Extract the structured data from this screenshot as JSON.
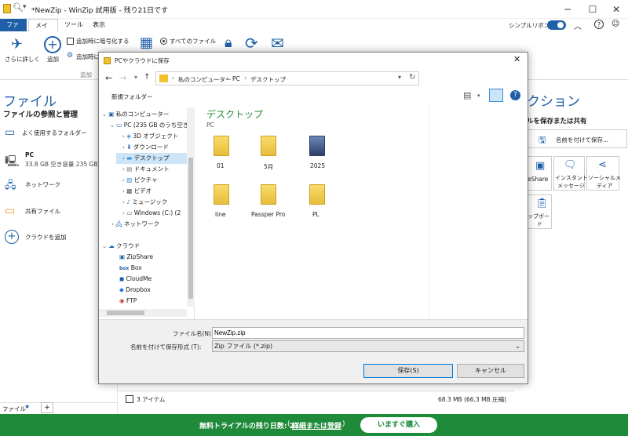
{
  "titlebar": {
    "title": "*NewZip - WinZip 試用版 - 残り21日です"
  },
  "tabs": [
    "ファイル",
    "メイン",
    "ツール",
    "表示"
  ],
  "ribbon": {
    "more_label": "さらに詳しく",
    "add_label": "追加",
    "encrypt_label": "追加時に暗号化する",
    "add_when_label": "追加時に",
    "group_add_label": "追加",
    "all_files_label": "すべてのファイル",
    "simple_ribbon_label": "シンプルリボン"
  },
  "leftpane": {
    "title": "ファイル",
    "subtitle": "ファイルの参照と管理",
    "frequent": "よく使用するフォルダー",
    "pc_label": "PC",
    "pc_detail": "33.8 GB 空き容量 235 GB",
    "network": "ネットワーク",
    "shared": "共有ファイル",
    "add_cloud": "クラウドを追加",
    "bottom_tab": "ファイル"
  },
  "rightpane": {
    "title": "クション",
    "subtitle": "ルを保存または共有",
    "save_as": "名前を付けて保存...",
    "meshare": "eShare",
    "instant1": "インスタント",
    "instant2": "メッセージ",
    "social1": "ソーシャルメ",
    "social2": "ディア",
    "clipboard1": "ップボー",
    "clipboard2": "ド"
  },
  "status": {
    "items": "3 アイテム",
    "size": "68.3 MB (66.3 MB 圧縮)"
  },
  "bottombar": {
    "trial_text": "無料トライアルの残り日数: 21",
    "trial_link": "詳細または登録",
    "buy_label": "いますぐ購入"
  },
  "dialog": {
    "title": "PCやクラウドに保存",
    "breadcrumb": [
      "私のコンピューター",
      "PC",
      "デスクトップ"
    ],
    "new_folder": "新規フォルダー",
    "folder_title": "デスクトップ",
    "folder_sub": "PC",
    "tree": [
      {
        "label": "私のコンピューター"
      },
      {
        "label": "PC (235 GB のうち空き"
      },
      {
        "label": "3D オブジェクト"
      },
      {
        "label": "ダウンロード"
      },
      {
        "label": "デスクトップ"
      },
      {
        "label": "ドキュメント"
      },
      {
        "label": "ピクチャ"
      },
      {
        "label": "ビデオ"
      },
      {
        "label": "ミュージック"
      },
      {
        "label": "Windows (C:) (2"
      },
      {
        "label": "ネットワーク"
      },
      {
        "label": "クラウド"
      },
      {
        "label": "ZipShare"
      },
      {
        "label": "Box"
      },
      {
        "label": "CloudMe"
      },
      {
        "label": "Dropbox"
      },
      {
        "label": "FTP"
      }
    ],
    "files": [
      {
        "name": "01"
      },
      {
        "name": "5月"
      },
      {
        "name": "2025"
      },
      {
        "name": "line"
      },
      {
        "name": "Passper Pro"
      },
      {
        "name": "PL"
      }
    ],
    "filename_label": "ファイル名(N):",
    "filename_value": "NewZip.zip",
    "type_label": "名前を付けて保存形式 (T):",
    "type_value": "Zip ファイル (*.zip)",
    "save_btn": "保存(S)",
    "cancel_btn": "キャンセル"
  },
  "colors": {
    "accent": "#1e5fa8",
    "green": "#1f8a3a",
    "file_tab": "#1e5fa8"
  }
}
